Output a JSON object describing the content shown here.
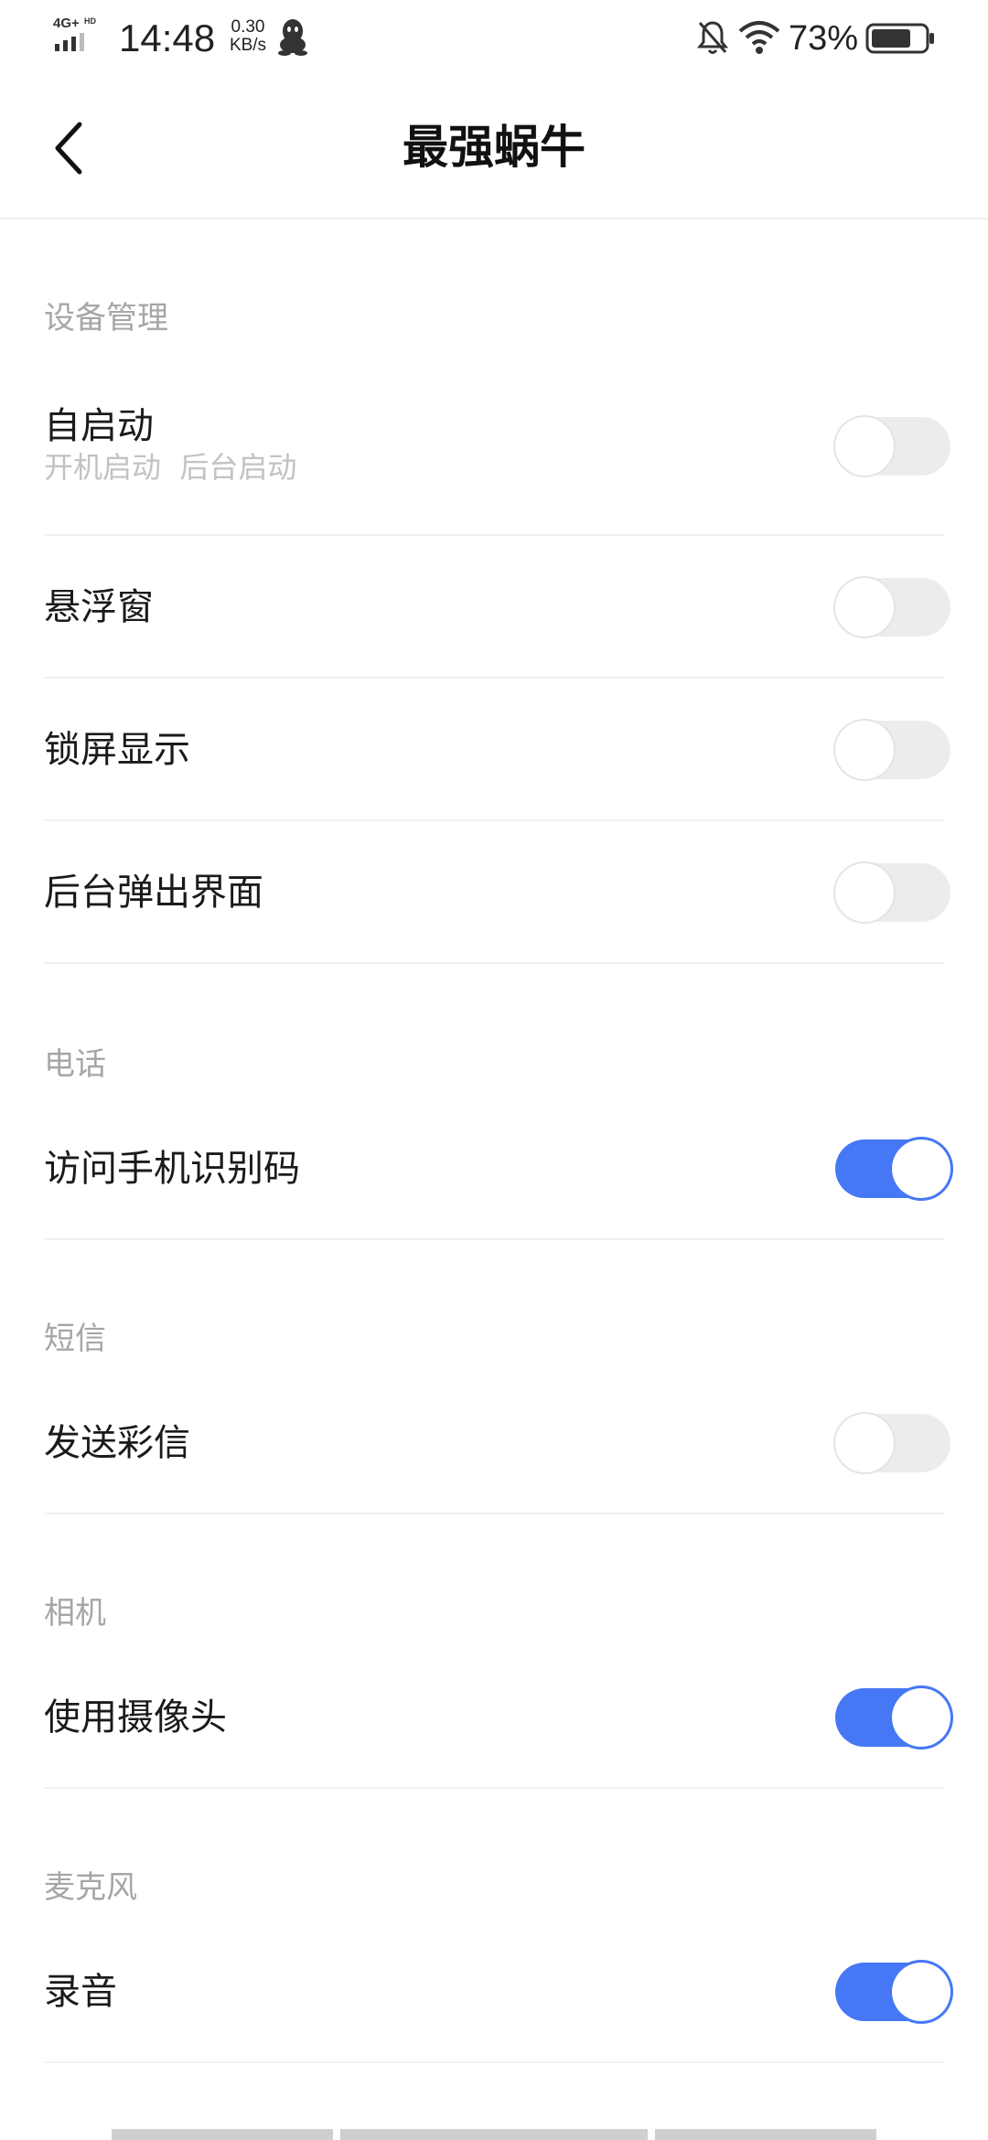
{
  "status_bar": {
    "network": "4G+",
    "network_sub": "HD",
    "time": "14:48",
    "speed_value": "0.30",
    "speed_unit": "KB/s",
    "battery": "73%",
    "icons": [
      "signal-icon",
      "qq-icon",
      "mute-bell-icon",
      "wifi-icon",
      "battery-icon"
    ]
  },
  "header": {
    "title": "最强蜗牛"
  },
  "sections": {
    "device": {
      "title": "设备管理",
      "autostart": {
        "label": "自启动",
        "sub": "开机启动  后台启动",
        "enabled": false
      },
      "float_window": {
        "label": "悬浮窗",
        "enabled": false
      },
      "lockscreen": {
        "label": "锁屏显示",
        "enabled": false
      },
      "bg_popup": {
        "label": "后台弹出界面",
        "enabled": false
      }
    },
    "phone": {
      "title": "电话",
      "imei": {
        "label": "访问手机识别码",
        "enabled": true
      }
    },
    "sms": {
      "title": "短信",
      "mms": {
        "label": "发送彩信",
        "enabled": false
      }
    },
    "camera": {
      "title": "相机",
      "use_camera": {
        "label": "使用摄像头",
        "enabled": true
      }
    },
    "mic": {
      "title": "麦克风",
      "record": {
        "label": "录音",
        "enabled": true
      }
    }
  },
  "colors": {
    "accent": "#4677f5",
    "toggle_off": "#ececec",
    "section_title": "#a6a6a6",
    "subtext": "#c2c2c2",
    "divider": "#f1f1f1"
  }
}
